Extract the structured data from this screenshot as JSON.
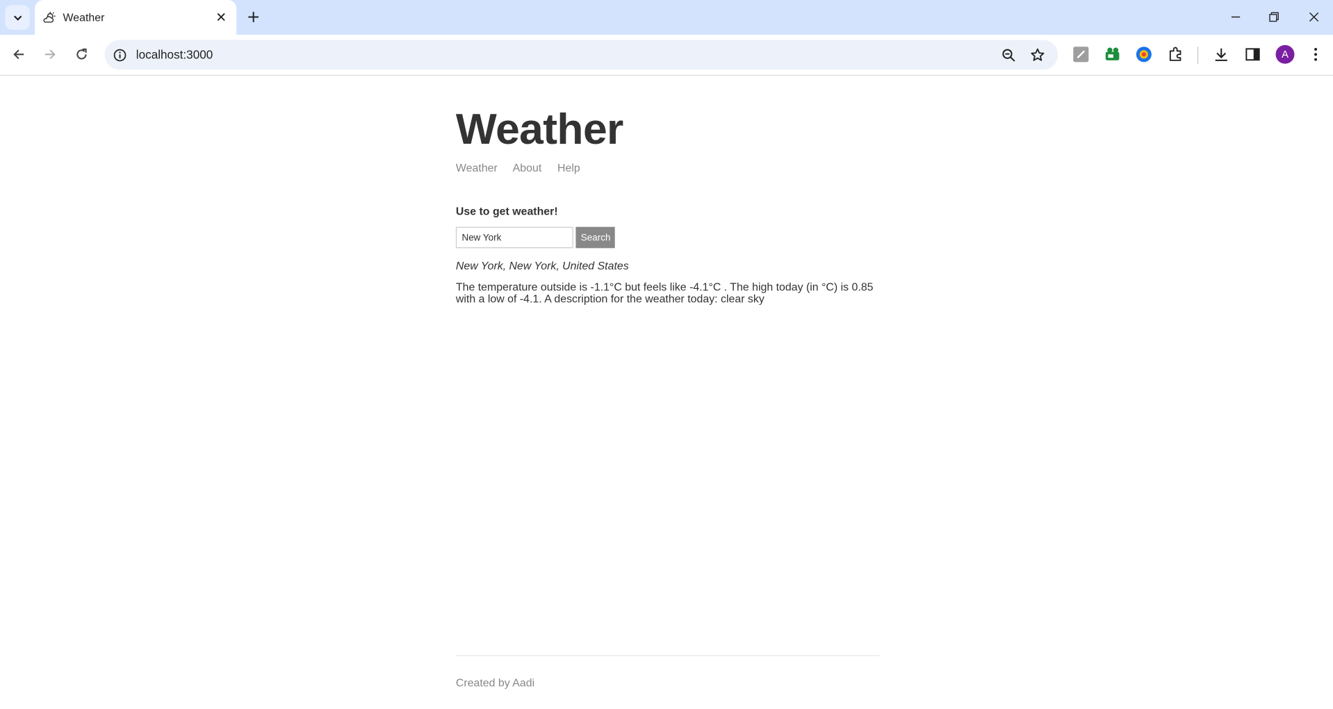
{
  "browser": {
    "tab_title": "Weather",
    "url": "localhost:3000",
    "profile_initial": "A"
  },
  "site": {
    "title": "Weather",
    "nav": [
      "Weather",
      "About",
      "Help"
    ],
    "prompt": "Use to get weather!",
    "search": {
      "value": "New York",
      "button_label": "Search"
    },
    "location": "New York, New York, United States",
    "forecast": "The temperature outside is -1.1°C but feels like -4.1°C . The high today (in °C) is 0.85 with a low of -4.1. A description for the weather today: clear sky",
    "footer": "Created by Aadi"
  }
}
